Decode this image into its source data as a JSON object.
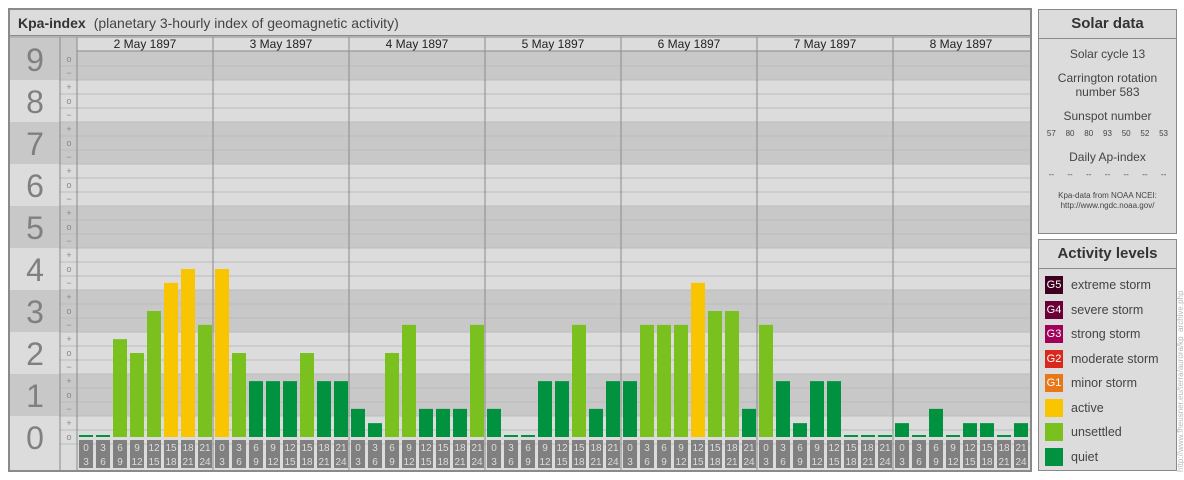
{
  "header": {
    "title": "Kpa-index",
    "subtitle": "(planetary 3-hourly index of geomagnetic activity)"
  },
  "solar": {
    "title": "Solar data",
    "cycle": "Solar cycle 13",
    "rotation_line1": "Carrington rotation",
    "rotation_line2": "number 583",
    "sunspot_label": "Sunspot number",
    "sunspots": [
      "57",
      "80",
      "80",
      "93",
      "50",
      "52",
      "53"
    ],
    "ap_label": "Daily Ap-index",
    "ap": [
      "--",
      "--",
      "--",
      "--",
      "--",
      "--",
      "--"
    ],
    "source_line1": "Kpa-data from NOAA NCEI:",
    "source_line2": "http://www.ngdc.noaa.gov/"
  },
  "activity": {
    "title": "Activity levels",
    "levels": [
      {
        "badge": "G5",
        "label": "extreme storm",
        "color": "#3e0020"
      },
      {
        "badge": "G4",
        "label": "severe storm",
        "color": "#6b0038"
      },
      {
        "badge": "G3",
        "label": "strong storm",
        "color": "#a1005a"
      },
      {
        "badge": "G2",
        "label": "moderate storm",
        "color": "#d9291c"
      },
      {
        "badge": "G1",
        "label": "minor storm",
        "color": "#e8771a"
      },
      {
        "badge": "",
        "label": "active",
        "color": "#f9c500"
      },
      {
        "badge": "",
        "label": "unsettled",
        "color": "#7ac120"
      },
      {
        "badge": "",
        "label": "quiet",
        "color": "#00923f"
      }
    ]
  },
  "watermark": "http://www.fheusner.eu/terra/aurora/kp_archive.php",
  "chart_data": {
    "type": "bar",
    "title": "Kpa-index",
    "ylabel": "Kp",
    "ylim": [
      0,
      9
    ],
    "y_ticks": [
      "0",
      "1",
      "2",
      "3",
      "4",
      "5",
      "6",
      "7",
      "8",
      "9"
    ],
    "y_subticks": [
      "o",
      "+",
      "-",
      "o",
      "+"
    ],
    "days": [
      "2 May 1897",
      "3 May 1897",
      "4 May 1897",
      "5 May 1897",
      "6 May 1897",
      "7 May 1897",
      "8 May 1897"
    ],
    "intervals": [
      [
        "0",
        "3"
      ],
      [
        "3",
        "6"
      ],
      [
        "6",
        "9"
      ],
      [
        "9",
        "12"
      ],
      [
        "12",
        "15"
      ],
      [
        "15",
        "18"
      ],
      [
        "18",
        "21"
      ],
      [
        "21",
        "24"
      ]
    ],
    "kp": [
      [
        "0o",
        "0o",
        "2+",
        "2o",
        "3o",
        "4-",
        "4o",
        "3-"
      ],
      [
        "4o",
        "2o",
        "1+",
        "1+",
        "1+",
        "2o",
        "1+",
        "1+"
      ],
      [
        "1-",
        "0+",
        "2o",
        "3-",
        "1-",
        "1-",
        "1-",
        "3-"
      ],
      [
        "1-",
        "0o",
        "0o",
        "1+",
        "1+",
        "3-",
        "1-",
        "1+"
      ],
      [
        "1+",
        "3-",
        "3-",
        "3-",
        "4-",
        "3o",
        "3o",
        "1-"
      ],
      [
        "3-",
        "1+",
        "0+",
        "1+",
        "1+",
        "0o",
        "0o",
        "0o"
      ],
      [
        "0+",
        "0o",
        "1-",
        "0o",
        "0+",
        "0+",
        "0o",
        "0+"
      ]
    ],
    "values": [
      [
        0,
        0,
        2.33,
        2,
        3,
        3.67,
        4,
        2.67
      ],
      [
        4,
        2,
        1.33,
        1.33,
        1.33,
        2,
        1.33,
        1.33
      ],
      [
        0.67,
        0.33,
        2,
        2.67,
        0.67,
        0.67,
        0.67,
        2.67
      ],
      [
        0.67,
        0,
        0,
        1.33,
        1.33,
        2.67,
        0.67,
        1.33
      ],
      [
        1.33,
        2.67,
        2.67,
        2.67,
        3.67,
        3,
        3,
        0.67
      ],
      [
        2.67,
        1.33,
        0.33,
        1.33,
        1.33,
        0,
        0,
        0
      ],
      [
        0.33,
        0,
        0.67,
        0,
        0.33,
        0.33,
        0,
        0.33
      ]
    ]
  }
}
